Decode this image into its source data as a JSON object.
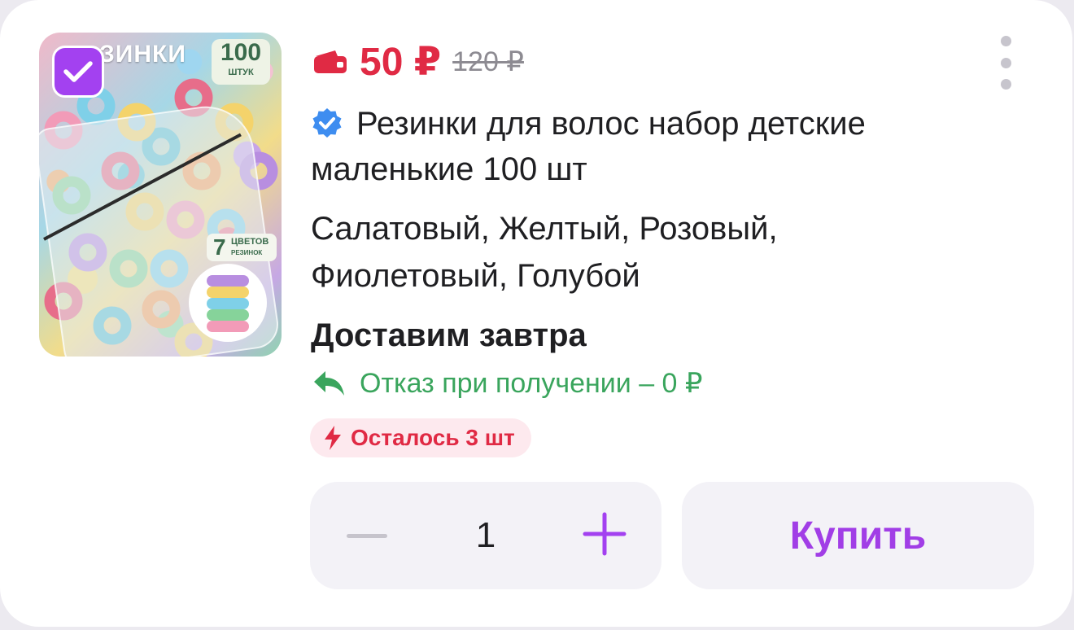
{
  "product": {
    "image_alt": "Резинки для волос",
    "image_texts": {
      "brand_strip": "ЗИНКИ",
      "count_number": "100",
      "count_unit": "ШТУК",
      "colors_number": "7",
      "colors_word": "ЦВЕТОВ",
      "colors_sub": "РЕЗИНОК"
    },
    "selected": true,
    "price": "50 ₽",
    "old_price": "120 ₽",
    "title": "Резинки для волос набор детские маленькие 100 шт",
    "colors": "Салатовый, Желтый, Розовый, Фиолетовый, Голубой",
    "delivery": "Доставим завтра",
    "refund": "Отказ при получении – 0 ₽",
    "stock": "Осталось 3 шт",
    "quantity": "1",
    "buy_label": "Купить"
  },
  "icons": {
    "wallet": "wallet-icon",
    "verified": "verified-badge-icon",
    "more": "more-vertical-icon",
    "refund": "reply-arrow-icon",
    "stock": "lightning-icon",
    "minus": "minus-icon",
    "plus": "plus-icon",
    "check": "checkmark-icon"
  },
  "colors_theme": {
    "price": "#e02a44",
    "accent": "#a341f0",
    "refund": "#3aa55d",
    "stock_bg": "#fde9ee"
  }
}
